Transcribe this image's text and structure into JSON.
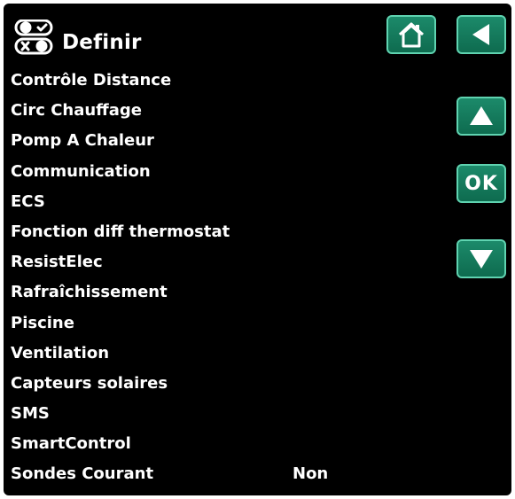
{
  "header": {
    "title": "Definir",
    "icon": "settings-toggle-icon"
  },
  "buttons": {
    "home": {
      "icon": "home-icon"
    },
    "back": {
      "icon": "back-arrow-icon"
    },
    "up": {
      "icon": "up-arrow-icon"
    },
    "ok": {
      "label": "OK"
    },
    "down": {
      "icon": "down-arrow-icon"
    }
  },
  "colors": {
    "background": "#000000",
    "text": "#ffffff",
    "button_fill": "#127a5b",
    "button_border": "#5fd3b0"
  },
  "menu": {
    "items": [
      {
        "label": "Contrôle Distance",
        "value": ""
      },
      {
        "label": "Circ Chauffage",
        "value": ""
      },
      {
        "label": "Pomp A Chaleur",
        "value": ""
      },
      {
        "label": "Communication",
        "value": ""
      },
      {
        "label": "ECS",
        "value": ""
      },
      {
        "label": "Fonction diff thermostat",
        "value": ""
      },
      {
        "label": "ResistElec",
        "value": ""
      },
      {
        "label": "Rafraîchissement",
        "value": ""
      },
      {
        "label": "Piscine",
        "value": ""
      },
      {
        "label": "Ventilation",
        "value": ""
      },
      {
        "label": "Capteurs solaires",
        "value": ""
      },
      {
        "label": "SMS",
        "value": ""
      },
      {
        "label": "SmartControl",
        "value": ""
      },
      {
        "label": "Sondes Courant",
        "value": "Non"
      }
    ]
  }
}
